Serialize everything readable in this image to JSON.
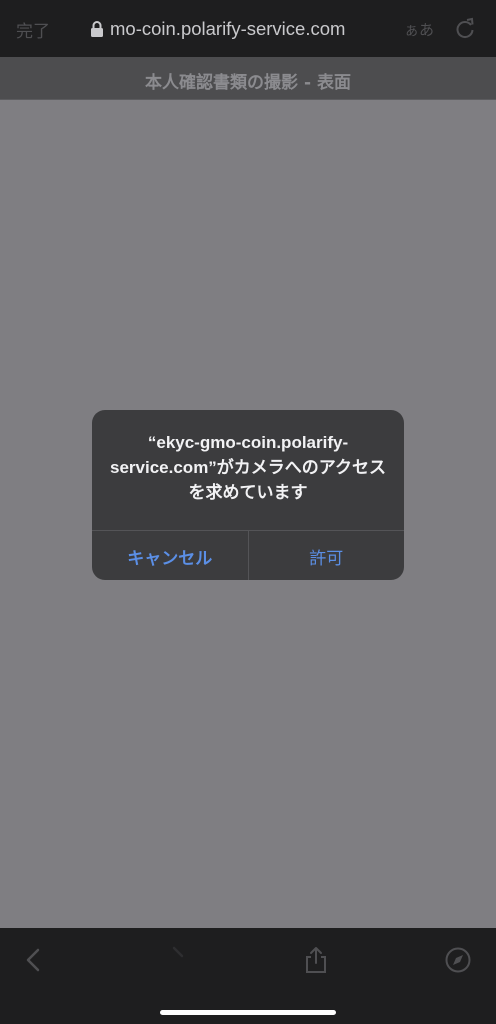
{
  "top_bar": {
    "done_label": "完了",
    "url": "mo-coin.polarify-service.com",
    "text_size_label": "ぁあ"
  },
  "page": {
    "title": "本人確認書類の撮影 - 表面"
  },
  "dialog": {
    "message": "“ekyc-gmo-coin.polarify-service.com”がカメラへのアクセスを求めています",
    "cancel_label": "キャンセル",
    "allow_label": "許可"
  },
  "toolbar": {
    "icons": [
      "back-icon",
      "forward-icon",
      "share-icon",
      "compass-icon"
    ]
  },
  "colors": {
    "accent": "#5b8fe6",
    "overlay": "#7f7e82",
    "bar": "#1e1e1f",
    "dialog_bg": "#3c3c3e"
  }
}
